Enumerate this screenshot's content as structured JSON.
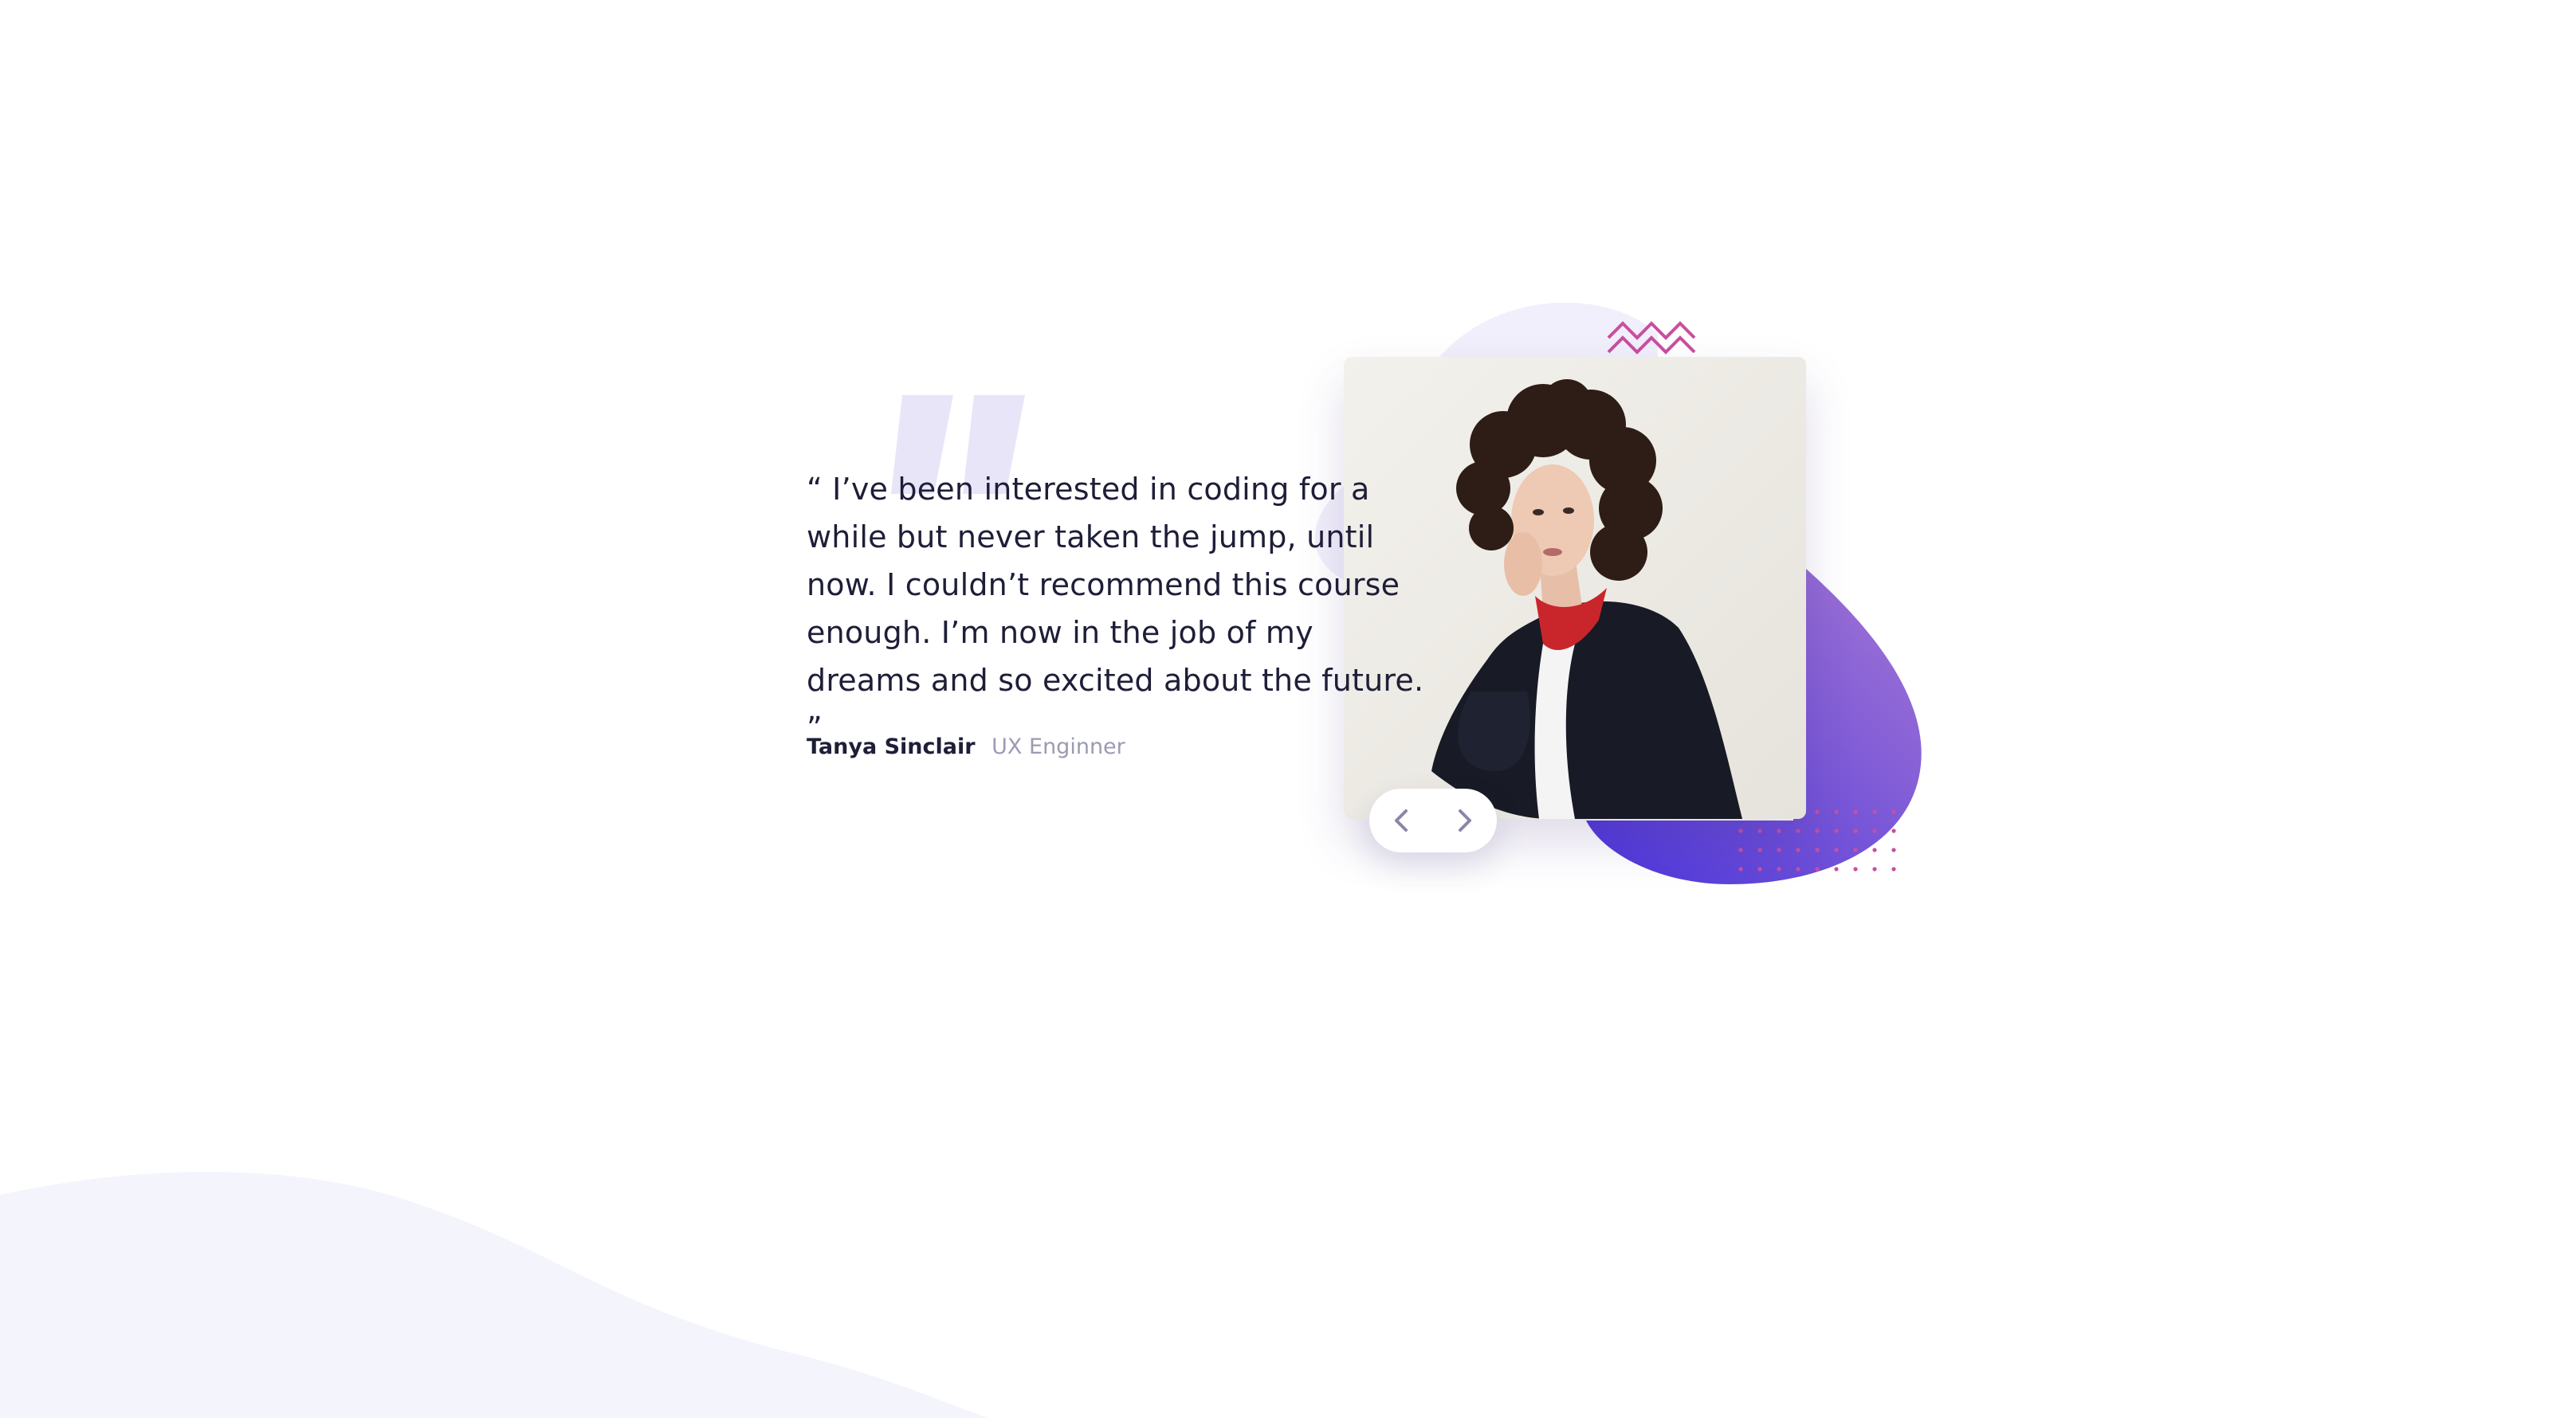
{
  "testimonial": {
    "quote": "“ I’ve been interested in coding for a while but never taken the jump, until now. I couldn’t recommend this course enough. I’m now in the job of my dreams and so excited about the future. ”",
    "author_name": "Tanya Sinclair",
    "author_role": "UX Enginner"
  },
  "icons": {
    "background_quote": "quote-mark-icon",
    "prev": "chevron-left-icon",
    "next": "chevron-right-icon",
    "zigzag": "zigzag-pattern-icon",
    "dots": "dot-grid-pattern-icon"
  },
  "colors": {
    "text": "#1e1e38",
    "muted": "#9b9bb2",
    "accent_start": "#5a34d6",
    "accent_end": "#9a6fd8",
    "pink": "#c84fa0",
    "light_bg": "#f2f3fb",
    "quote_mark": "#e7e3f8"
  }
}
